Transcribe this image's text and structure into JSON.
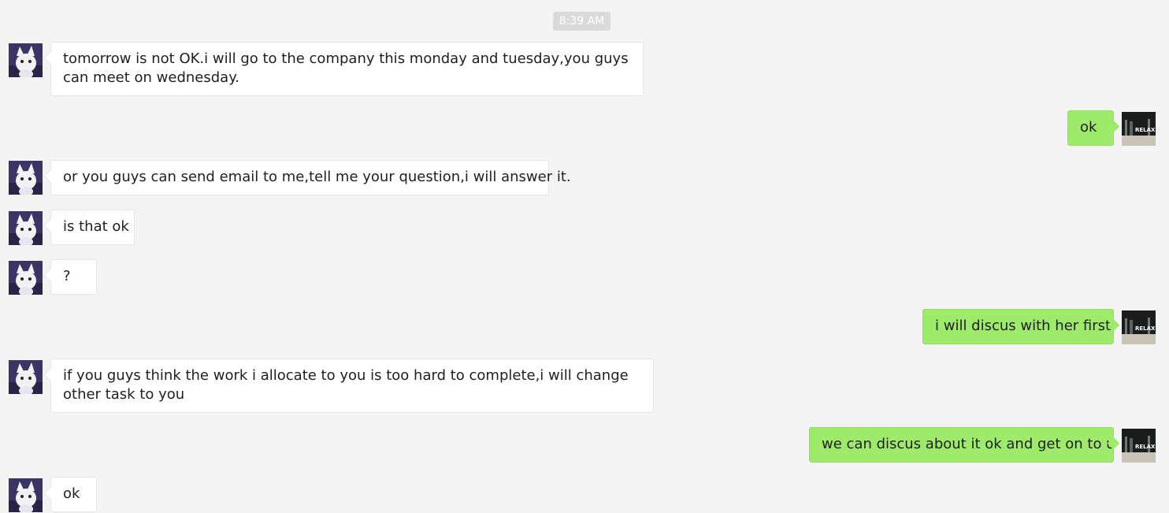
{
  "timestamp": "8:39 AM",
  "messages": [
    {
      "side": "in",
      "text": "tomorrow is not OK.i will go to the company this monday and tuesday,you guys can meet on wednesday."
    },
    {
      "side": "out",
      "text": "ok"
    },
    {
      "side": "in",
      "text": "or you guys can send email to me,tell me your question,i will answer it."
    },
    {
      "side": "in",
      "text": "is that ok"
    },
    {
      "side": "in",
      "text": "?"
    },
    {
      "side": "out",
      "text": "i will discus with her first"
    },
    {
      "side": "in",
      "text": "if you guys think the work i allocate to you is too hard to complete,i will change other task to you"
    },
    {
      "side": "out",
      "text": "we can discus about it ok and get on to u"
    },
    {
      "side": "in",
      "text": "ok"
    }
  ],
  "avatars": {
    "contact": {
      "icon": "cartoon-cat-avatar-icon",
      "colors": [
        "#3b3566",
        "#f2f2f5"
      ]
    },
    "self": {
      "icon": "relax-photo-avatar-icon",
      "label": "RELAX"
    }
  },
  "colors": {
    "background": "#f4f4f4",
    "incoming_bubble": "#ffffff",
    "outgoing_bubble": "#9eea6a",
    "timestamp_bg": "#dadada"
  }
}
